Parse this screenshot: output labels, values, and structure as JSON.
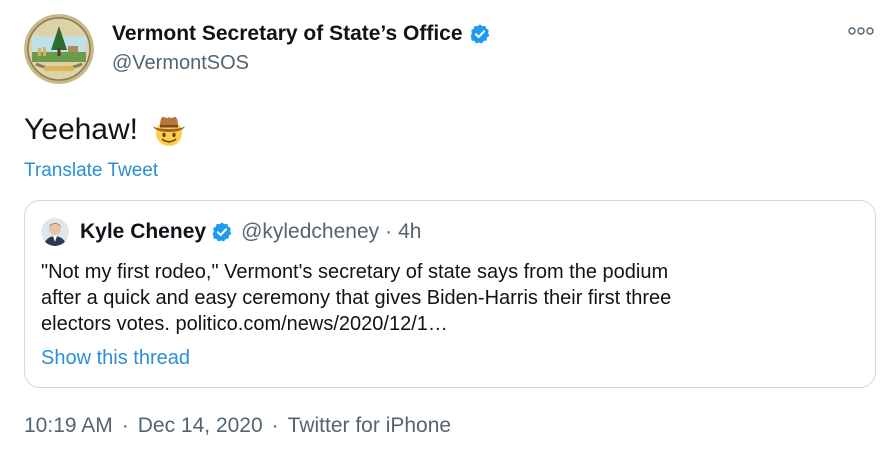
{
  "author": {
    "display_name": "Vermont Secretary of State’s Office",
    "handle": "@VermontSOS",
    "avatar": "vermont-state-seal",
    "verified_icon": "verified-badge-icon"
  },
  "tweet": {
    "text": "Yeehaw!",
    "emoji": "cowboy-hat-face-emoji",
    "translate_label": "Translate Tweet"
  },
  "quoted_tweet": {
    "display_name": "Kyle Cheney",
    "handle": "@kyledcheney",
    "separator": "·",
    "time": "4h",
    "body_lines": [
      "\"Not my first rodeo,\" Vermont's secretary of state says from the podium",
      "after a quick and easy ceremony that gives Biden-Harris their first three",
      "electors votes. politico.com/news/2020/12/1…"
    ],
    "show_thread_label": "Show this thread"
  },
  "meta": {
    "time": "10:19 AM",
    "separator": "·",
    "date": "Dec 14, 2020",
    "source": "Twitter for iPhone"
  },
  "colors": {
    "link_blue": "#2a8fd6",
    "secondary_text": "#536471",
    "border": "#cfd9de",
    "verified_blue": "#1d9bf0"
  }
}
